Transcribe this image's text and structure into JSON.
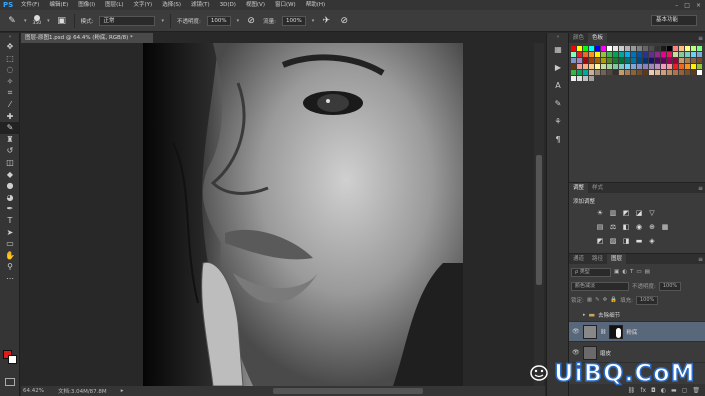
{
  "app": {
    "logo": "PS",
    "menu": [
      "文件(F)",
      "编辑(E)",
      "图像(I)",
      "图层(L)",
      "文字(Y)",
      "选择(S)",
      "滤镜(T)",
      "3D(D)",
      "视图(V)",
      "窗口(W)",
      "帮助(H)"
    ],
    "window_controls": [
      "–",
      "□",
      "×"
    ]
  },
  "options_bar": {
    "brush_size": "350",
    "mode_label": "模式:",
    "mode_value": "正常",
    "opacity_label": "不透明度:",
    "opacity_value": "100%",
    "flow_label": "流量:",
    "flow_value": "100%",
    "workspace": "基本功能"
  },
  "document": {
    "tab_title": "图层-原图1.psd @ 64.4% (粉底, RGB/8) *",
    "zoom": "64.42%",
    "doc_info": "文档:3.04M/87.8M"
  },
  "swatches_panel": {
    "tabs": [
      "颜色",
      "色板"
    ],
    "active_tab": "色板",
    "colors": [
      "#ff0000",
      "#ffff00",
      "#00ff00",
      "#00ffff",
      "#0000ff",
      "#ff00ff",
      "#ffffff",
      "#e6e6e6",
      "#cccccc",
      "#b3b3b3",
      "#999999",
      "#808080",
      "#666666",
      "#4d4d4d",
      "#333333",
      "#1a1a1a",
      "#000000",
      "#ff8080",
      "#ffbf80",
      "#ffff80",
      "#bfff80",
      "#80ff80",
      "#80ffbf",
      "#ed1c24",
      "#f26522",
      "#f7941d",
      "#fff200",
      "#8dc63f",
      "#39b54a",
      "#00a651",
      "#00a99d",
      "#00aeef",
      "#0072bc",
      "#0054a6",
      "#2e3192",
      "#662d91",
      "#92278f",
      "#ec008c",
      "#ed145b",
      "#c4df9b",
      "#82ca9c",
      "#7accc8",
      "#6dcff6",
      "#7da7d9",
      "#8393ca",
      "#a187be",
      "#9e0b0f",
      "#a0410d",
      "#a36209",
      "#aba000",
      "#598527",
      "#197b30",
      "#007236",
      "#00746b",
      "#0076a3",
      "#004a80",
      "#003471",
      "#1b1464",
      "#440e62",
      "#630460",
      "#9e005d",
      "#9e0039",
      "#c69c6d",
      "#a67c52",
      "#8c6239",
      "#754c24",
      "#603913",
      "#f5989d",
      "#f9ad81",
      "#fdc68a",
      "#fff799",
      "#c4df9b",
      "#a3d39c",
      "#82ca9c",
      "#7accc8",
      "#6dcff6",
      "#7da7d9",
      "#8393ca",
      "#8781bd",
      "#a187be",
      "#bc8dbf",
      "#f49ac2",
      "#f6989d",
      "#ee1d24",
      "#f16522",
      "#f7941d",
      "#fff100",
      "#8fc63d",
      "#37b44a",
      "#00a650",
      "#00a99e",
      "#c7b299",
      "#998675",
      "#736357",
      "#534741",
      "#37302d",
      "#c69c6d",
      "#a67c52",
      "#8c6239",
      "#754c24",
      "#603913",
      "#e6cdb4",
      "#d7b99a",
      "#c8a27f",
      "#b98c66",
      "#a9774f",
      "#8f633f",
      "#754f30",
      "#5b3c22",
      "#ffffff",
      "#eeeeee",
      "#dddddd",
      "#c0c0c0",
      "#a0a0a0"
    ]
  },
  "adjust_panel": {
    "tabs": [
      "调整",
      "样式"
    ],
    "active_tab": "调整",
    "title": "添加调整"
  },
  "layers_panel": {
    "tabs": [
      "通道",
      "路径",
      "图层"
    ],
    "active_tab": "图层",
    "filter_label": "ρ 类型",
    "blend_mode": "颜色减淡",
    "opacity_label": "不透明度:",
    "opacity_value": "100%",
    "lock_label": "锁定:",
    "fill_label": "填充:",
    "fill_value": "100%",
    "layers": [
      {
        "name": "去除细节",
        "type": "group",
        "selected": false,
        "visible": false
      },
      {
        "name": "粉底",
        "type": "layer-with-mask",
        "selected": true,
        "visible": true
      },
      {
        "name": "磨皮",
        "type": "layer",
        "selected": false,
        "visible": true
      }
    ],
    "footer_icons": [
      "link-icon",
      "fx-icon",
      "mask-icon",
      "adjustment-icon",
      "folder-icon",
      "new-layer-icon",
      "trash-icon"
    ]
  },
  "watermark": {
    "text": "UiBQ.CoM"
  }
}
